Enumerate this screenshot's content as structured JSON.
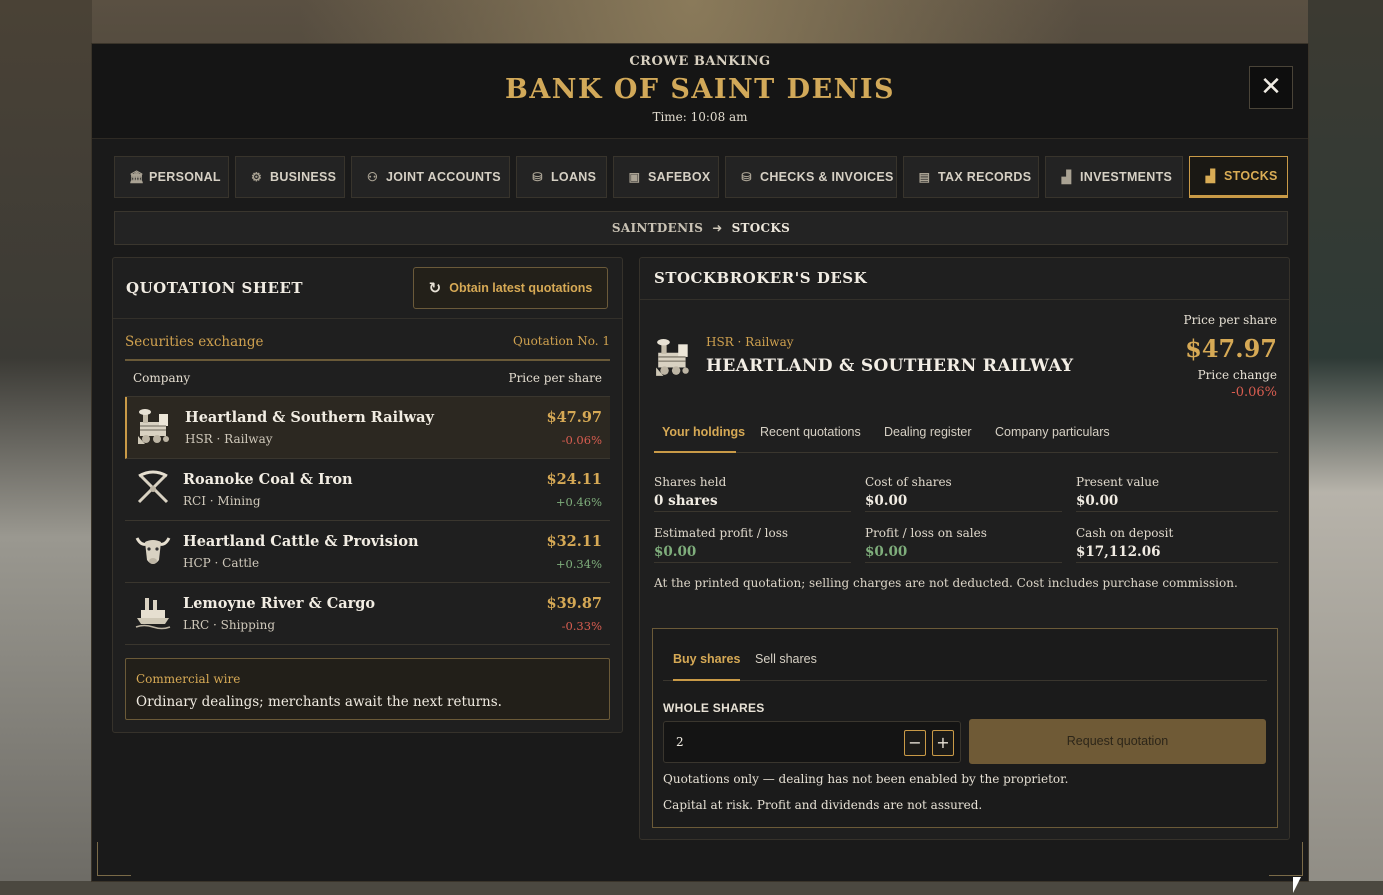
{
  "header": {
    "brand": "CROWE BANKING",
    "title": "BANK OF SAINT DENIS",
    "time": "Time: 10:08 am",
    "close_label": "✕"
  },
  "tabs": [
    {
      "label": "PERSONAL",
      "icon": "bank-icon",
      "glyph": "🏛"
    },
    {
      "label": "BUSINESS",
      "icon": "business-icon",
      "glyph": "⚙"
    },
    {
      "label": "JOINT ACCOUNTS",
      "icon": "people-icon",
      "glyph": "⚇"
    },
    {
      "label": "LOANS",
      "icon": "coins-icon",
      "glyph": "⛁"
    },
    {
      "label": "SAFEBOX",
      "icon": "safe-icon",
      "glyph": "▣"
    },
    {
      "label": "CHECKS & INVOICES",
      "icon": "checks-icon",
      "glyph": "⛁"
    },
    {
      "label": "TAX RECORDS",
      "icon": "document-icon",
      "glyph": "▤"
    },
    {
      "label": "INVESTMENTS",
      "icon": "bar-chart-icon",
      "glyph": "▟"
    },
    {
      "label": "STOCKS",
      "icon": "stocks-chart-icon",
      "glyph": "▟",
      "active": true
    }
  ],
  "breadcrumb": {
    "location": "SAINTDENIS",
    "arrow": "➜",
    "current": "STOCKS"
  },
  "quotation_sheet": {
    "title": "QUOTATION SHEET",
    "obtain_label": "Obtain latest quotations",
    "exchange_label": "Securities exchange",
    "quotation_no": "Quotation No. 1",
    "col_company": "Company",
    "col_price": "Price per share",
    "companies": [
      {
        "name": "Heartland & Southern Railway",
        "sub": "HSR · Railway",
        "price": "$47.97",
        "change": "-0.06%",
        "trend": "neg",
        "icon": "locomotive-icon",
        "selected": true
      },
      {
        "name": "Roanoke Coal & Iron",
        "sub": "RCI · Mining",
        "price": "$24.11",
        "change": "+0.46%",
        "trend": "pos",
        "icon": "pickaxes-icon"
      },
      {
        "name": "Heartland Cattle & Provision",
        "sub": "HCP · Cattle",
        "price": "$32.11",
        "change": "+0.34%",
        "trend": "pos",
        "icon": "bull-head-icon"
      },
      {
        "name": "Lemoyne River & Cargo",
        "sub": "LRC · Shipping",
        "price": "$39.87",
        "change": "-0.33%",
        "trend": "neg",
        "icon": "steamboat-icon"
      }
    ],
    "wire_label": "Commercial wire",
    "wire_text": "Ordinary dealings; merchants await the next returns."
  },
  "desk": {
    "title": "STOCKBROKER'S DESK",
    "symbol_sector": "HSR · Railway",
    "company_name": "HEARTLAND & SOUTHERN RAILWAY",
    "price_label": "Price per share",
    "price": "$47.97",
    "change_label": "Price change",
    "change": "-0.06%",
    "subtabs": [
      "Your holdings",
      "Recent quotations",
      "Dealing register",
      "Company particulars"
    ],
    "stats": [
      {
        "label": "Shares held",
        "value": "0 shares"
      },
      {
        "label": "Cost of shares",
        "value": "$0.00"
      },
      {
        "label": "Present value",
        "value": "$0.00"
      },
      {
        "label": "Estimated profit / loss",
        "value": "$0.00",
        "trend": "pos"
      },
      {
        "label": "Profit / loss on sales",
        "value": "$0.00",
        "trend": "pos"
      },
      {
        "label": "Cash on deposit",
        "value": "$17,112.06"
      }
    ],
    "note": "At the printed quotation; selling charges are not deducted. Cost includes purchase commission.",
    "trade": {
      "tabs": [
        "Buy shares",
        "Sell shares"
      ],
      "shares_label": "WHOLE SHARES",
      "shares_value": "2",
      "minus": "−",
      "plus": "+",
      "request_label": "Request quotation",
      "disclaimer1": "Quotations only — dealing has not been enabled by the proprietor.",
      "disclaimer2": "Capital at risk. Profit and dividends are not assured."
    }
  },
  "colors": {
    "accent": "#d6a955",
    "negative": "#d85d50",
    "positive": "#7fae7c",
    "panel": "#1a1a1a"
  }
}
